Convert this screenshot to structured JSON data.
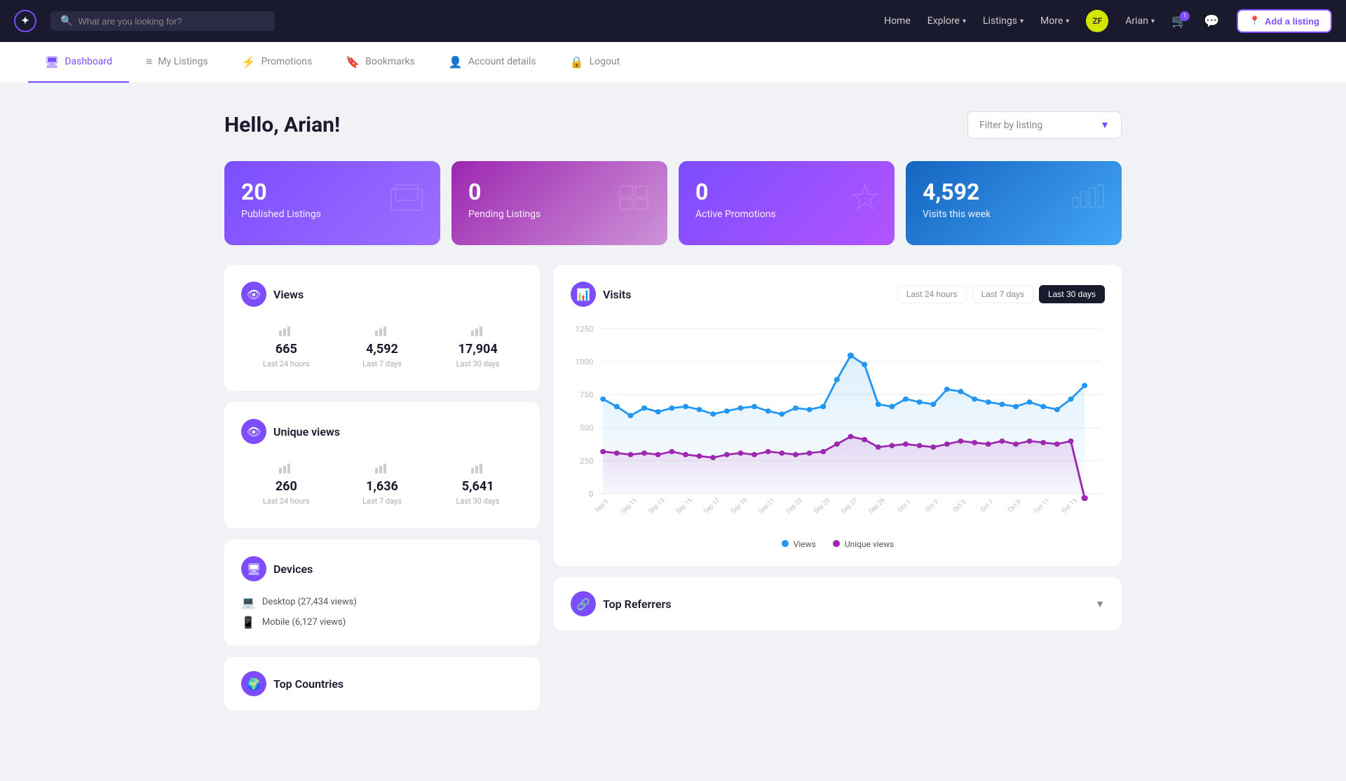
{
  "topnav": {
    "logo_text": "✦",
    "search_placeholder": "What are you looking for?",
    "links": [
      {
        "label": "Home",
        "has_dropdown": false
      },
      {
        "label": "Explore",
        "has_dropdown": true
      },
      {
        "label": "Listings",
        "has_dropdown": true
      },
      {
        "label": "More",
        "has_dropdown": true
      }
    ],
    "user_name": "Arian",
    "user_initials": "ZF",
    "cart_count": "1",
    "add_listing_label": "Add a listing",
    "location_icon": "📍"
  },
  "subnav": {
    "items": [
      {
        "label": "Dashboard",
        "icon": "🖥",
        "active": true
      },
      {
        "label": "My Listings",
        "icon": "≡",
        "active": false
      },
      {
        "label": "Promotions",
        "icon": "⚡",
        "active": false
      },
      {
        "label": "Bookmarks",
        "icon": "🔖",
        "active": false
      },
      {
        "label": "Account details",
        "icon": "👤",
        "active": false
      },
      {
        "label": "Logout",
        "icon": "🔒",
        "active": false
      }
    ]
  },
  "header": {
    "greeting": "Hello, Arian!",
    "filter_label": "Filter by listing",
    "filter_chevron": "▼"
  },
  "stat_cards": [
    {
      "value": "20",
      "label": "Published Listings",
      "icon": "⬜"
    },
    {
      "value": "0",
      "label": "Pending Listings",
      "icon": "⬜"
    },
    {
      "value": "0",
      "label": "Active Promotions",
      "icon": "⚡"
    },
    {
      "value": "4,592",
      "label": "Visits this week",
      "icon": "📊"
    }
  ],
  "views_panel": {
    "title": "Views",
    "icon": "👁",
    "stats": [
      {
        "value": "665",
        "label": "Last 24 hours"
      },
      {
        "value": "4,592",
        "label": "Last 7 days"
      },
      {
        "value": "17,904",
        "label": "Last 30 days"
      }
    ]
  },
  "unique_views_panel": {
    "title": "Unique views",
    "icon": "👁",
    "stats": [
      {
        "value": "260",
        "label": "Last 24 hours"
      },
      {
        "value": "1,636",
        "label": "Last 7 days"
      },
      {
        "value": "5,641",
        "label": "Last 30 days"
      }
    ]
  },
  "devices_panel": {
    "title": "Devices",
    "icon": "🖥",
    "items": [
      {
        "icon": "💻",
        "label": "Desktop (27,434 views)"
      },
      {
        "icon": "📱",
        "label": "Mobile (6,127 views)"
      }
    ]
  },
  "top_countries_panel": {
    "title": "Top Countries",
    "icon": "🌍"
  },
  "visits_chart": {
    "title": "Visits",
    "icon": "📊",
    "filters": [
      {
        "label": "Last 24 hours",
        "active": false
      },
      {
        "label": "Last 7 days",
        "active": false
      },
      {
        "label": "Last 30 days",
        "active": true
      }
    ],
    "y_labels": [
      "1250",
      "1000",
      "750",
      "500",
      "250",
      "0"
    ],
    "legend": [
      {
        "label": "Views",
        "color": "#2196f3"
      },
      {
        "label": "Unique views",
        "color": "#9c27b0"
      }
    ]
  },
  "referrers_panel": {
    "title": "Top Referrers",
    "icon": "🔗",
    "chevron": "▼"
  }
}
